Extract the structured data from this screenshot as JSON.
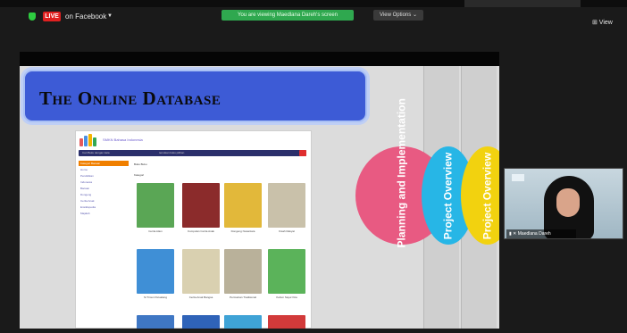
{
  "zoom": {
    "live_badge": "LIVE",
    "live_target": "on Facebook",
    "viewing_banner": "You are viewing Maedlana Dareh's screen",
    "view_options": "View Options ⌄",
    "view_button": "⊞ View"
  },
  "slide": {
    "title": "The Online Database",
    "tabs": [
      {
        "label": "Planning and Implementation",
        "color": "#e85a82"
      },
      {
        "label": "Project Overview",
        "color": "#27b6e6"
      },
      {
        "label": "Project Overview",
        "color": "#f2d20f"
      }
    ]
  },
  "database_screenshot": {
    "logo_title": "SMKN Bahasa Indonesia",
    "search_placeholder": "Cari Buku dengan kata",
    "search_hint": "temukan buku pilihan",
    "sidebar_header": "Kategori Bacaan",
    "sidebar_items": [
      "Home",
      "Pendidikan",
      "Indonesia",
      "Bacaan",
      "Dongeng",
      "Cerita Anak",
      "Ensiklopedia",
      "Majalah"
    ],
    "main_title": "Buku Buku",
    "main_subtitle": "Kategori",
    "books": [
      {
        "caption": "Cerita Alam",
        "color": "#5aa655"
      },
      {
        "caption": "Kumpulan Cerita Anak",
        "color": "#8b2b2b"
      },
      {
        "caption": "Dongeng Nusantara",
        "color": "#e2b83a"
      },
      {
        "caption": "Kisah Rakyat",
        "color": "#c9c1aa"
      },
      {
        "caption": "Si Timun Petualang",
        "color": "#3f8fd6"
      },
      {
        "caption": "Cerita Anak Bangsa",
        "color": "#d9d0b0"
      },
      {
        "caption": "Permainan Tradisional",
        "color": "#b9b19a"
      },
      {
        "caption": "Kebun Sayur Kita",
        "color": "#5bb35a"
      },
      {
        "caption": "",
        "color": "#3f77c4"
      },
      {
        "caption": "",
        "color": "#2f63b8"
      },
      {
        "caption": "",
        "color": "#3fa3d6"
      },
      {
        "caption": "",
        "color": "#d23a3a"
      }
    ]
  },
  "participant": {
    "name": "Maedlana Dareh"
  },
  "icons": [
    "shield-icon",
    "caret-down-icon",
    "grid-view-icon",
    "mic-off-icon",
    "search-icon"
  ]
}
